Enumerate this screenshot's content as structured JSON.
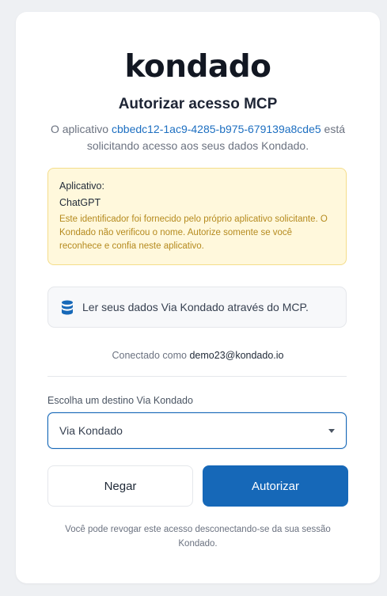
{
  "brand": {
    "logo_text": "kondado"
  },
  "header": {
    "title": "Autorizar acesso MCP"
  },
  "subtitle": {
    "prefix": "O aplicativo ",
    "app_id": "cbbedc12-1ac9-4285-b975-679139a8cde5",
    "suffix": " está solicitando acesso aos seus dados Kondado."
  },
  "app_notice": {
    "label": "Aplicativo:",
    "app_name": "ChatGPT",
    "note": "Este identificador foi fornecido pelo próprio aplicativo solicitante. O Kondado não verificou o nome. Autorize somente se você reconhece e confia neste aplicativo."
  },
  "scope": {
    "icon": "database-icon",
    "text": "Ler seus dados Via Kondado através do MCP."
  },
  "connected": {
    "prefix": "Conectado como ",
    "email": "demo23@kondado.io"
  },
  "destination": {
    "label": "Escolha um destino Via Kondado",
    "selected": "Via Kondado"
  },
  "actions": {
    "deny_label": "Negar",
    "authorize_label": "Autorizar"
  },
  "footer": {
    "text": "Você pode revogar este acesso desconectando-se da sua sessão Kondado."
  },
  "colors": {
    "accent": "#1668b8",
    "link": "#1d6fc1",
    "warning_bg": "#fff8dc",
    "warning_border": "#f4dd8a",
    "warning_text": "#b58a1e"
  }
}
